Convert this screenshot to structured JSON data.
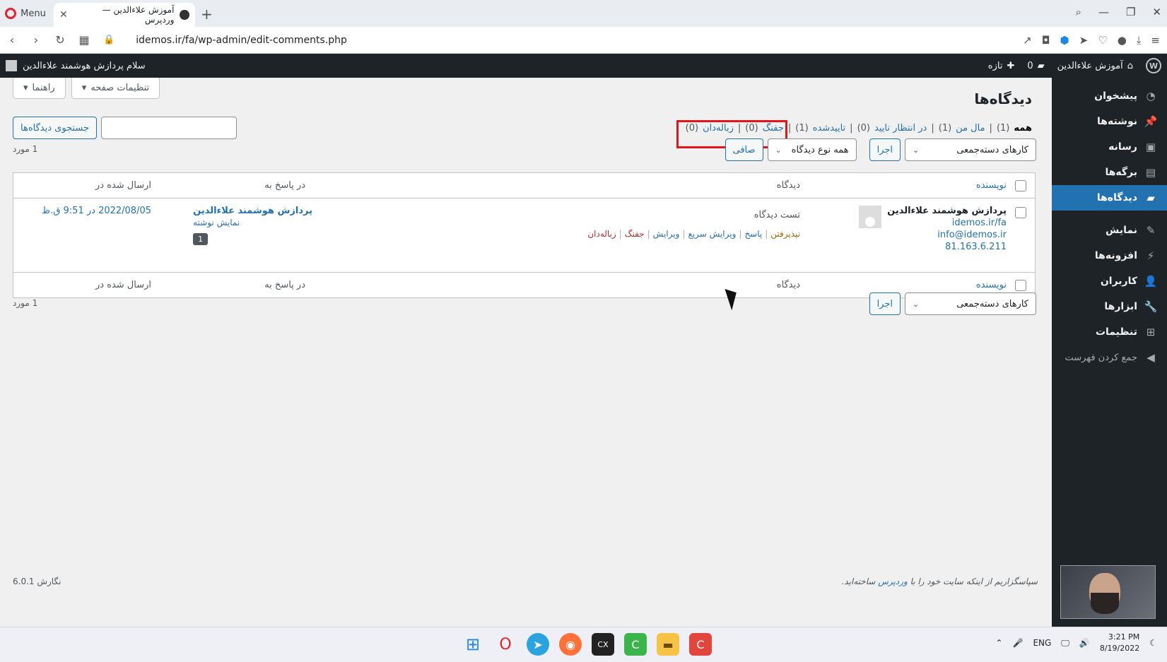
{
  "browser": {
    "menu_label": "Menu",
    "tab_title": "آموزش علاءالدین — وردپرس",
    "url": "idemos.ir/fa/wp-admin/edit-comments.php"
  },
  "adminbar": {
    "site_name": "آموزش علاءالدین",
    "comments_count": "0",
    "new_label": "تازه",
    "howdy": "سلام پردازش هوشمند علاءالدین"
  },
  "sidebar": {
    "items": [
      {
        "label": "پیشخوان",
        "icon": "dashboard-icon"
      },
      {
        "label": "نوشته‌ها",
        "icon": "pin-icon"
      },
      {
        "label": "رسانه",
        "icon": "media-icon"
      },
      {
        "label": "برگه‌ها",
        "icon": "page-icon"
      },
      {
        "label": "دیدگاه‌ها",
        "icon": "comment-icon"
      },
      {
        "label": "نمایش",
        "icon": "brush-icon"
      },
      {
        "label": "افزونه‌ها",
        "icon": "plugin-icon"
      },
      {
        "label": "کاربران",
        "icon": "user-icon"
      },
      {
        "label": "ابزارها",
        "icon": "wrench-icon"
      },
      {
        "label": "تنظیمات",
        "icon": "settings-icon"
      }
    ],
    "collapse_label": "جمع کردن فهرست"
  },
  "main": {
    "title": "دیدگاه‌ها",
    "screen_options": "تنظیمات صفحه",
    "help": "راهنما",
    "filters": {
      "all": "همه",
      "all_count": "(1)",
      "mine": "مال من",
      "mine_count": "(1)",
      "pending": "در انتظار تایید",
      "pending_count": "(0)",
      "approved": "تاییدشده",
      "approved_count": "(1)",
      "spam": "جفنگ",
      "spam_count": "(0)",
      "trash": "زباله‌دان",
      "trash_count": "(0)"
    },
    "search_button": "جستجوی دیدگاه‌ها",
    "search_placeholder": "",
    "bulk_actions": "کارهای دسته‌جمعی",
    "apply": "اجرا",
    "comment_type": "همه نوع دیدگاه",
    "filter_button": "صافی",
    "item_count": "1 مورد",
    "columns": {
      "author": "نویسنده",
      "comment": "دیدگاه",
      "response": "در پاسخ به",
      "date": "ارسال شده در"
    },
    "row": {
      "author_name": "پردازش هوشمند علاءالدین",
      "author_url": "idemos.ir/fa",
      "author_email": "info@idemos.ir",
      "author_ip": "81.163.6.211",
      "comment_text": "تست دیدگاه",
      "actions": {
        "approve": "نپذیرفتن",
        "reply": "پاسخ",
        "quick_edit": "ویرایش سریع",
        "edit": "ویرایش",
        "spam": "جفنگ",
        "trash": "زباله‌دان"
      },
      "response_title": "پردازش هوشمند علاءالدین",
      "response_view": "نمایش نوشته",
      "response_count": "1",
      "date": "2022/08/05 در 9:51 ق.ظ"
    },
    "footer_thanks_prefix": "سپاسگزاریم از اینکه سایت خود را با ",
    "footer_thanks_link": "وردپرس",
    "footer_thanks_suffix": " ساخته‌اید.",
    "version": "نگارش 6.0.1"
  },
  "taskbar": {
    "lang": "ENG",
    "time": "3:21 PM",
    "date": "8/19/2022"
  }
}
